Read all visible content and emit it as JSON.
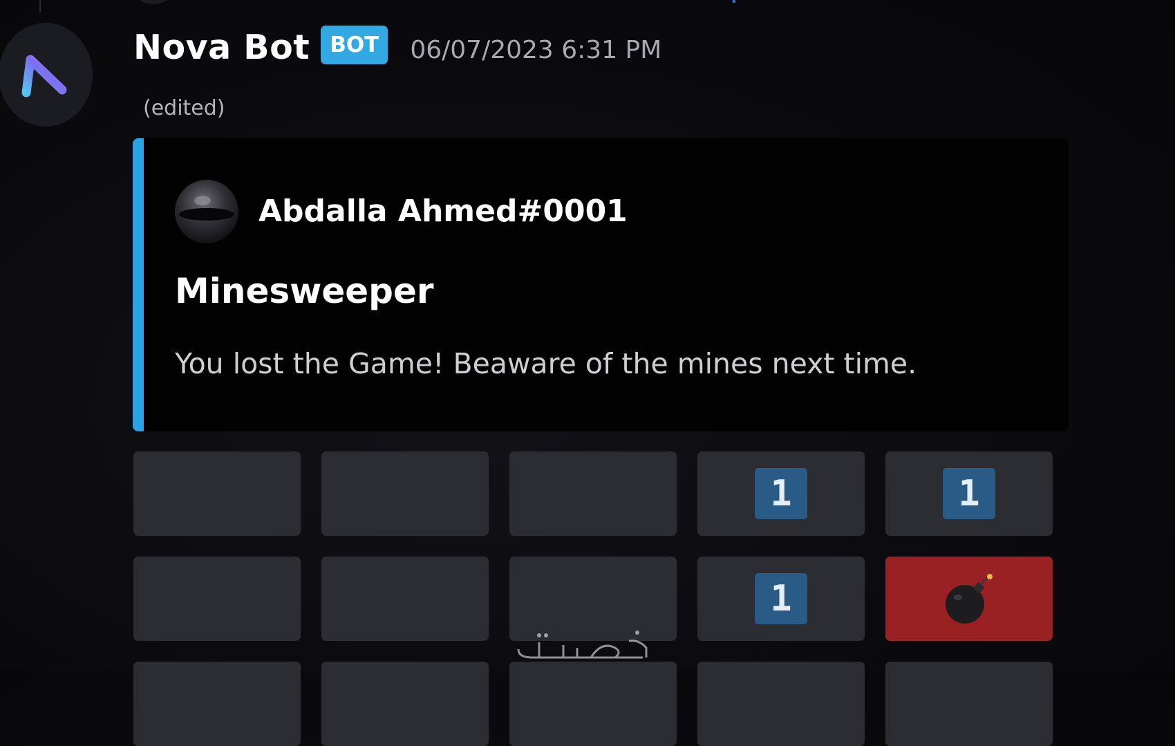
{
  "message": {
    "author": "Nova Bot",
    "badge": "BOT",
    "timestamp": "06/07/2023 6:31 PM",
    "edited_label": "(edited)"
  },
  "embed": {
    "accent_color": "#29a3e6",
    "author_name": "Abdalla Ahmed#0001",
    "title": "Minesweeper",
    "description": "You lost the Game! Beaware of the mines next time."
  },
  "board": {
    "rows": [
      [
        {
          "state": "empty",
          "label": ""
        },
        {
          "state": "empty",
          "label": ""
        },
        {
          "state": "empty",
          "label": ""
        },
        {
          "state": "number",
          "label": "1"
        },
        {
          "state": "number",
          "label": "1"
        }
      ],
      [
        {
          "state": "empty",
          "label": ""
        },
        {
          "state": "empty",
          "label": ""
        },
        {
          "state": "empty",
          "label": ""
        },
        {
          "state": "number",
          "label": "1"
        },
        {
          "state": "mine",
          "label": "",
          "icon": "bomb-icon"
        }
      ]
    ],
    "colors": {
      "cell": "#2c2d32",
      "number_chip": "#2a5b86",
      "mine": "#992124"
    }
  }
}
